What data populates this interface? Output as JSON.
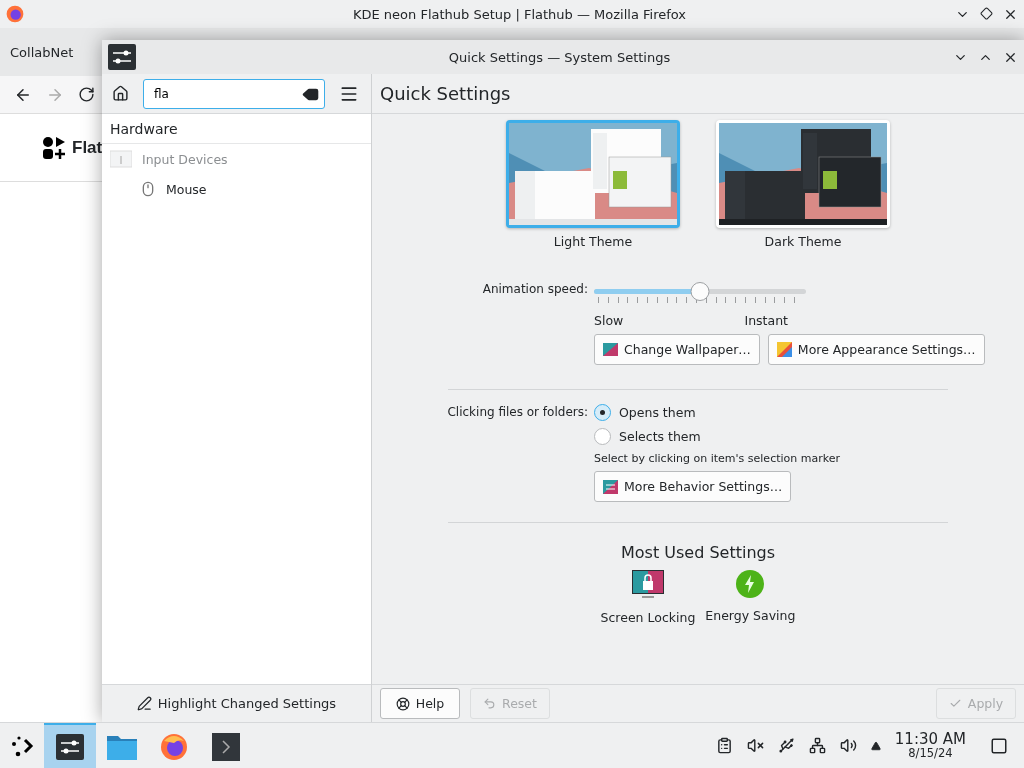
{
  "browser": {
    "title": "KDE neon Flathub Setup | Flathub — Mozilla Firefox",
    "tab": "CollabNet",
    "logo_text": "Flat"
  },
  "window": {
    "title": "Quick Settings — System Settings"
  },
  "sidebar": {
    "search": {
      "value": "fla"
    },
    "tree": [
      {
        "label": "Hardware",
        "kind": "header",
        "children": [
          {
            "label": "Input Devices",
            "kind": "category",
            "disabled": true,
            "children": [
              {
                "label": "Mouse",
                "kind": "mouse",
                "disabled": false
              }
            ]
          }
        ]
      }
    ],
    "footer_button": "Highlight Changed Settings"
  },
  "page": {
    "title": "Quick Settings",
    "themes": [
      {
        "label": "Light Theme",
        "kind": "light",
        "selected": true
      },
      {
        "label": "Dark Theme",
        "kind": "dark",
        "selected": false
      }
    ],
    "animation": {
      "label": "Animation speed:",
      "level": 0.5,
      "min_label": "Slow",
      "max_label": "Instant"
    },
    "appearance_buttons": [
      {
        "label": "Change Wallpaper…",
        "kind": "wallpaper"
      },
      {
        "label": "More Appearance Settings…",
        "kind": "appearance"
      }
    ],
    "clicking": {
      "label": "Clicking files or folders:",
      "options": [
        {
          "label": "Opens them",
          "selected": true
        },
        {
          "label": "Selects them",
          "selected": false
        }
      ],
      "hint": "Select by clicking on item's selection marker",
      "button": "More Behavior Settings…"
    },
    "most_used": {
      "title": "Most Used Settings",
      "items": [
        {
          "label": "Screen Locking",
          "kind": "lock"
        },
        {
          "label": "Energy Saving",
          "kind": "energy"
        }
      ]
    }
  },
  "footer_buttons": [
    {
      "label": "Help",
      "kind": "help",
      "disabled": false
    },
    {
      "label": "Reset",
      "kind": "reset",
      "disabled": true
    },
    {
      "label": "Apply",
      "kind": "apply",
      "disabled": true
    }
  ],
  "taskbar": {
    "tasks": [
      {
        "kind": "settings",
        "selected": true
      },
      {
        "kind": "files",
        "selected": false
      },
      {
        "kind": "firefox",
        "selected": false
      },
      {
        "kind": "terminal",
        "selected": false
      }
    ],
    "clock": {
      "time": "11:30 AM",
      "date": "8/15/24"
    }
  }
}
